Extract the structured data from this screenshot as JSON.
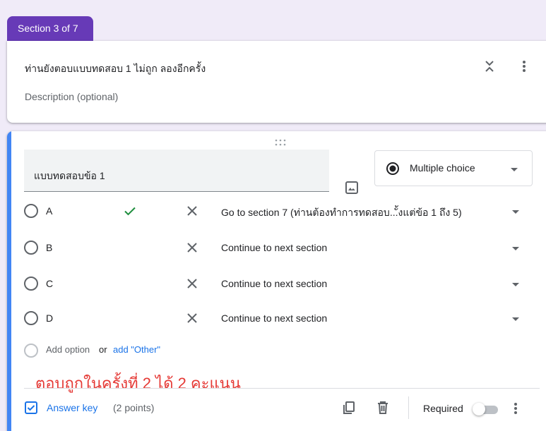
{
  "section": {
    "tab_label": "Section 3 of 7",
    "title": "ท่านยังตอบแบบทดสอบ 1 ไม่ถูก ลองอีกครั้ง",
    "description_placeholder": "Description (optional)"
  },
  "question": {
    "title": "แบบทดสอบข้อ 1",
    "type": "Multiple choice",
    "options": [
      {
        "label": "A",
        "correct": true,
        "goto": "Go to section 7 (ท่านต้องทำการทดสอบ...ั้งแต่ข้อ 1 ถึง 5)"
      },
      {
        "label": "B",
        "correct": false,
        "goto": "Continue to next section"
      },
      {
        "label": "C",
        "correct": false,
        "goto": "Continue to next section"
      },
      {
        "label": "D",
        "correct": false,
        "goto": "Continue to next section"
      }
    ],
    "add_option": "Add option",
    "or_text": "or",
    "add_other": "add \"Other\""
  },
  "annotation": "ตอบถูกในครั้งที่ 2 ได้ 2 คะแนน",
  "footer": {
    "answer_key": "Answer key",
    "points": "(2 points)",
    "required_label": "Required",
    "required_on": false
  },
  "colors": {
    "accent": "#673ab7",
    "active_bar": "#4285f4",
    "link": "#1a73e8",
    "correct": "#1e8e3e",
    "annotation": "#e53935"
  }
}
